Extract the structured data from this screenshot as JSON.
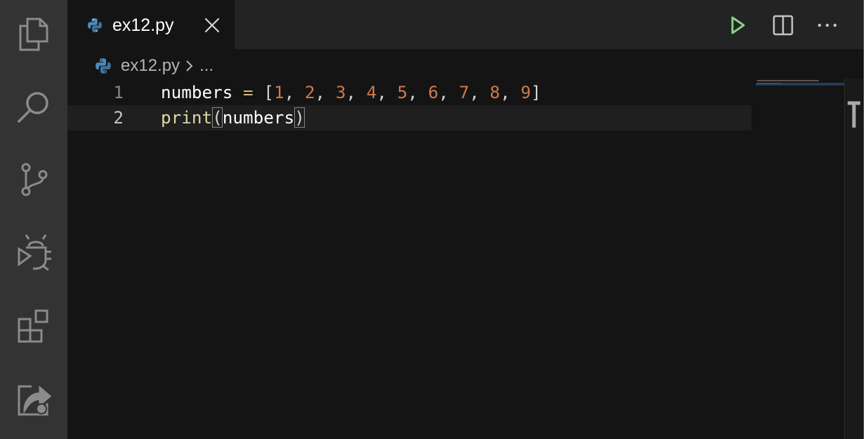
{
  "activity_bar": {
    "icons": [
      "explorer-icon",
      "search-icon",
      "source-control-icon",
      "run-debug-icon",
      "extensions-icon",
      "live-share-icon"
    ]
  },
  "tab": {
    "filename": "ex12.py",
    "icon": "python-file-icon",
    "close_icon": "close-icon"
  },
  "toolbar": {
    "icons": [
      "run-icon",
      "split-editor-icon",
      "more-actions-icon"
    ]
  },
  "breadcrumb": {
    "file": "ex12.py",
    "separator_icon": "chevron-right-icon",
    "more": "..."
  },
  "editor": {
    "lines": [
      {
        "number": "1",
        "text": "numbers = [1, 2, 3, 4, 5, 6, 7, 8, 9]"
      },
      {
        "number": "2",
        "text": "print(numbers)"
      }
    ],
    "code": {
      "l1_var": "numbers",
      "l1_eq": "=",
      "l1_open": "[",
      "l1_nums": [
        "1",
        "2",
        "3",
        "4",
        "5",
        "6",
        "7",
        "8",
        "9"
      ],
      "l1_comma": ",",
      "l1_close": "]",
      "l2_fn": "print",
      "l2_open": "(",
      "l2_arg": "numbers",
      "l2_close": ")"
    }
  },
  "colors": {
    "accent_python_blue": "#4b8bbe",
    "number": "#d0794c",
    "operator": "#d7ba7d",
    "function": "#dcdcaa",
    "run_green": "#89d185"
  }
}
